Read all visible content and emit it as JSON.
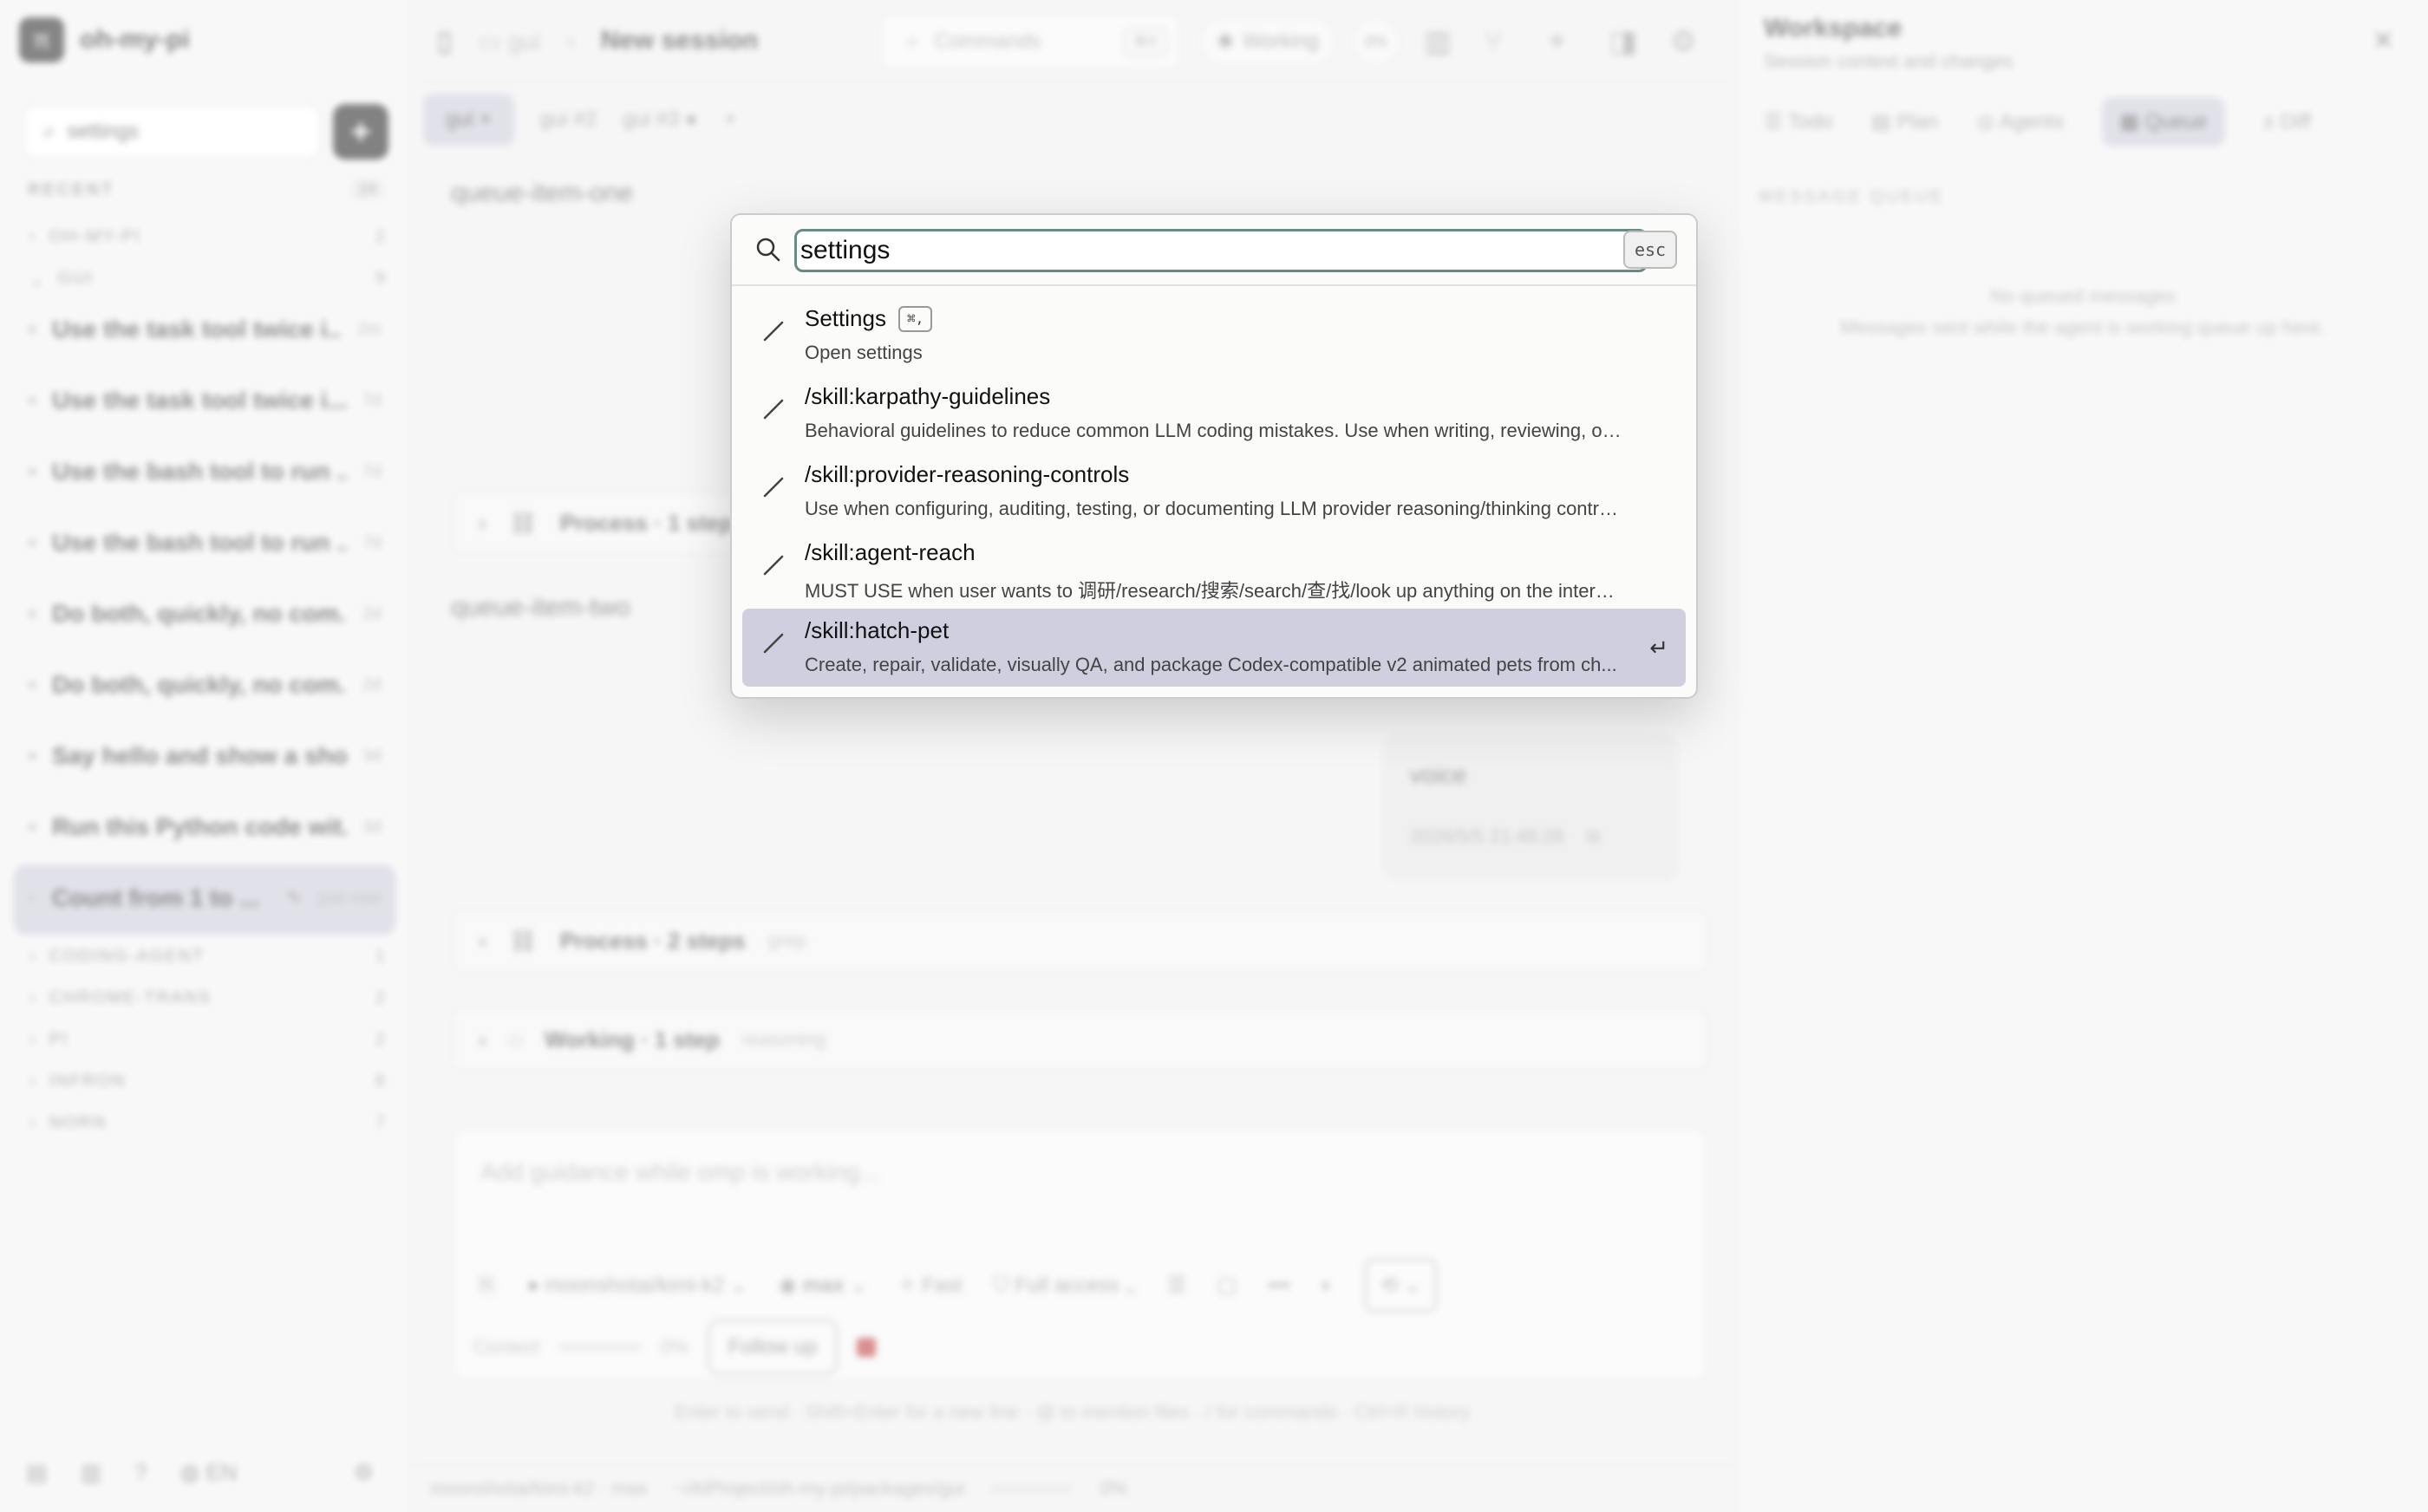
{
  "app": {
    "name": "oh-my-pi"
  },
  "sidebar": {
    "search_value": "settings",
    "recent_label": "RECENT",
    "recent_count": "24",
    "groups_top": [
      {
        "label": "OH-MY-PI",
        "count": "2"
      },
      {
        "label": "GUI",
        "count": "9"
      }
    ],
    "items": [
      {
        "label": "Use the task tool twice i...",
        "age": "2m"
      },
      {
        "label": "Use the task tool twice i...",
        "age": "7d"
      },
      {
        "label": "Use the bash tool to run ...",
        "age": "7d"
      },
      {
        "label": "Use the bash tool to run ...",
        "age": "7d"
      },
      {
        "label": "Do both, quickly, no com...",
        "age": "2d"
      },
      {
        "label": "Do both, quickly, no com...",
        "age": "2d"
      },
      {
        "label": "Say hello and show a sho...",
        "age": "3d"
      },
      {
        "label": "Run this Python code wit...",
        "age": "3d"
      }
    ],
    "active_item": {
      "label": "Count from 1 to ...",
      "age": "just now"
    },
    "groups_bottom": [
      {
        "label": "CODING-AGENT",
        "count": "1"
      },
      {
        "label": "CHROME-TRANS",
        "count": "2"
      },
      {
        "label": "PI",
        "count": "2"
      },
      {
        "label": "INFRON",
        "count": "6"
      },
      {
        "label": "NORN",
        "count": "7"
      }
    ],
    "footer_lang": "EN"
  },
  "topbar": {
    "crumb_project": "gui",
    "title": "New session",
    "commands_label": "Commands",
    "commands_kbd": "⌘K",
    "working_label": "Working",
    "pct_label": "0%"
  },
  "tabs": [
    {
      "label": "gui"
    },
    {
      "label": "gui #2"
    },
    {
      "label": "gui #3"
    }
  ],
  "conversation": {
    "queue_one": "queue-item-one",
    "queue_two": "queue-item-two",
    "process1": {
      "title": "Process · 1 step"
    },
    "voice": {
      "text": "voice",
      "timestamp": "2026/5/5 21:48:28"
    },
    "process2": {
      "title": "Process · 2 steps",
      "meta": "grep"
    },
    "working": {
      "title": "Working · 1 step",
      "meta": "reasoning"
    }
  },
  "composer": {
    "placeholder": "Add guidance while omp is working...",
    "model": "moonshotai/kimi-k2",
    "effort": "max",
    "fast": "Fast",
    "access": "Full access",
    "context_label": "Context",
    "context_pct": "0%",
    "follow_up": "Follow up",
    "hint": "Enter to send · Shift+Enter for a new line · @ to mention files · / for commands · Ctrl+R history"
  },
  "statusbar": {
    "model": "moonshotai/kimi-k2 · max",
    "path": "~/AIProject/oh-my-pi/packages/gui",
    "pct": "0%"
  },
  "workspace": {
    "title": "Workspace",
    "subtitle": "Session context and changes",
    "tabs": [
      "Todo",
      "Plan",
      "Agents",
      "Queue",
      "Diff"
    ],
    "section": "MESSAGE QUEUE",
    "empty_title": "No queued messages",
    "empty_sub": "Messages sent while the agent is working queue up here."
  },
  "palette": {
    "query": "settings",
    "esc_label": "esc",
    "items": [
      {
        "name": "Settings",
        "kbd": "⌘,",
        "desc": "Open settings"
      },
      {
        "name": "/skill:karpathy-guidelines",
        "desc": "Behavioral guidelines to reduce common LLM coding mistakes. Use when writing, reviewing, or ref..."
      },
      {
        "name": "/skill:provider-reasoning-controls",
        "desc": "Use when configuring, auditing, testing, or documenting LLM provider reasoning/thinking controls, ..."
      },
      {
        "name": "/skill:agent-reach",
        "desc": "MUST USE when user wants to 调研/research/搜索/search/查/找/look up anything on the internet — ..."
      },
      {
        "name": "/skill:hatch-pet",
        "desc": "Create, repair, validate, visually QA, and package Codex-compatible v2 animated pets from ch...",
        "selected": true
      }
    ]
  },
  "colors": {
    "accent_selection": "#cfcfe0",
    "input_focus": "#6a8a86",
    "stop": "#b33333"
  }
}
